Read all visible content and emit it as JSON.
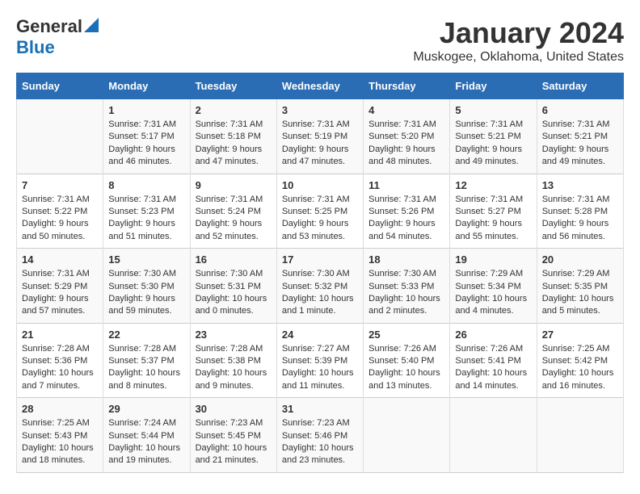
{
  "header": {
    "logo_general": "General",
    "logo_blue": "Blue",
    "month": "January 2024",
    "location": "Muskogee, Oklahoma, United States"
  },
  "days_of_week": [
    "Sunday",
    "Monday",
    "Tuesday",
    "Wednesday",
    "Thursday",
    "Friday",
    "Saturday"
  ],
  "weeks": [
    [
      {
        "day": "",
        "info": ""
      },
      {
        "day": "1",
        "info": "Sunrise: 7:31 AM\nSunset: 5:17 PM\nDaylight: 9 hours\nand 46 minutes."
      },
      {
        "day": "2",
        "info": "Sunrise: 7:31 AM\nSunset: 5:18 PM\nDaylight: 9 hours\nand 47 minutes."
      },
      {
        "day": "3",
        "info": "Sunrise: 7:31 AM\nSunset: 5:19 PM\nDaylight: 9 hours\nand 47 minutes."
      },
      {
        "day": "4",
        "info": "Sunrise: 7:31 AM\nSunset: 5:20 PM\nDaylight: 9 hours\nand 48 minutes."
      },
      {
        "day": "5",
        "info": "Sunrise: 7:31 AM\nSunset: 5:21 PM\nDaylight: 9 hours\nand 49 minutes."
      },
      {
        "day": "6",
        "info": "Sunrise: 7:31 AM\nSunset: 5:21 PM\nDaylight: 9 hours\nand 49 minutes."
      }
    ],
    [
      {
        "day": "7",
        "info": "Sunrise: 7:31 AM\nSunset: 5:22 PM\nDaylight: 9 hours\nand 50 minutes."
      },
      {
        "day": "8",
        "info": "Sunrise: 7:31 AM\nSunset: 5:23 PM\nDaylight: 9 hours\nand 51 minutes."
      },
      {
        "day": "9",
        "info": "Sunrise: 7:31 AM\nSunset: 5:24 PM\nDaylight: 9 hours\nand 52 minutes."
      },
      {
        "day": "10",
        "info": "Sunrise: 7:31 AM\nSunset: 5:25 PM\nDaylight: 9 hours\nand 53 minutes."
      },
      {
        "day": "11",
        "info": "Sunrise: 7:31 AM\nSunset: 5:26 PM\nDaylight: 9 hours\nand 54 minutes."
      },
      {
        "day": "12",
        "info": "Sunrise: 7:31 AM\nSunset: 5:27 PM\nDaylight: 9 hours\nand 55 minutes."
      },
      {
        "day": "13",
        "info": "Sunrise: 7:31 AM\nSunset: 5:28 PM\nDaylight: 9 hours\nand 56 minutes."
      }
    ],
    [
      {
        "day": "14",
        "info": "Sunrise: 7:31 AM\nSunset: 5:29 PM\nDaylight: 9 hours\nand 57 minutes."
      },
      {
        "day": "15",
        "info": "Sunrise: 7:30 AM\nSunset: 5:30 PM\nDaylight: 9 hours\nand 59 minutes."
      },
      {
        "day": "16",
        "info": "Sunrise: 7:30 AM\nSunset: 5:31 PM\nDaylight: 10 hours\nand 0 minutes."
      },
      {
        "day": "17",
        "info": "Sunrise: 7:30 AM\nSunset: 5:32 PM\nDaylight: 10 hours\nand 1 minute."
      },
      {
        "day": "18",
        "info": "Sunrise: 7:30 AM\nSunset: 5:33 PM\nDaylight: 10 hours\nand 2 minutes."
      },
      {
        "day": "19",
        "info": "Sunrise: 7:29 AM\nSunset: 5:34 PM\nDaylight: 10 hours\nand 4 minutes."
      },
      {
        "day": "20",
        "info": "Sunrise: 7:29 AM\nSunset: 5:35 PM\nDaylight: 10 hours\nand 5 minutes."
      }
    ],
    [
      {
        "day": "21",
        "info": "Sunrise: 7:28 AM\nSunset: 5:36 PM\nDaylight: 10 hours\nand 7 minutes."
      },
      {
        "day": "22",
        "info": "Sunrise: 7:28 AM\nSunset: 5:37 PM\nDaylight: 10 hours\nand 8 minutes."
      },
      {
        "day": "23",
        "info": "Sunrise: 7:28 AM\nSunset: 5:38 PM\nDaylight: 10 hours\nand 9 minutes."
      },
      {
        "day": "24",
        "info": "Sunrise: 7:27 AM\nSunset: 5:39 PM\nDaylight: 10 hours\nand 11 minutes."
      },
      {
        "day": "25",
        "info": "Sunrise: 7:26 AM\nSunset: 5:40 PM\nDaylight: 10 hours\nand 13 minutes."
      },
      {
        "day": "26",
        "info": "Sunrise: 7:26 AM\nSunset: 5:41 PM\nDaylight: 10 hours\nand 14 minutes."
      },
      {
        "day": "27",
        "info": "Sunrise: 7:25 AM\nSunset: 5:42 PM\nDaylight: 10 hours\nand 16 minutes."
      }
    ],
    [
      {
        "day": "28",
        "info": "Sunrise: 7:25 AM\nSunset: 5:43 PM\nDaylight: 10 hours\nand 18 minutes."
      },
      {
        "day": "29",
        "info": "Sunrise: 7:24 AM\nSunset: 5:44 PM\nDaylight: 10 hours\nand 19 minutes."
      },
      {
        "day": "30",
        "info": "Sunrise: 7:23 AM\nSunset: 5:45 PM\nDaylight: 10 hours\nand 21 minutes."
      },
      {
        "day": "31",
        "info": "Sunrise: 7:23 AM\nSunset: 5:46 PM\nDaylight: 10 hours\nand 23 minutes."
      },
      {
        "day": "",
        "info": ""
      },
      {
        "day": "",
        "info": ""
      },
      {
        "day": "",
        "info": ""
      }
    ]
  ]
}
